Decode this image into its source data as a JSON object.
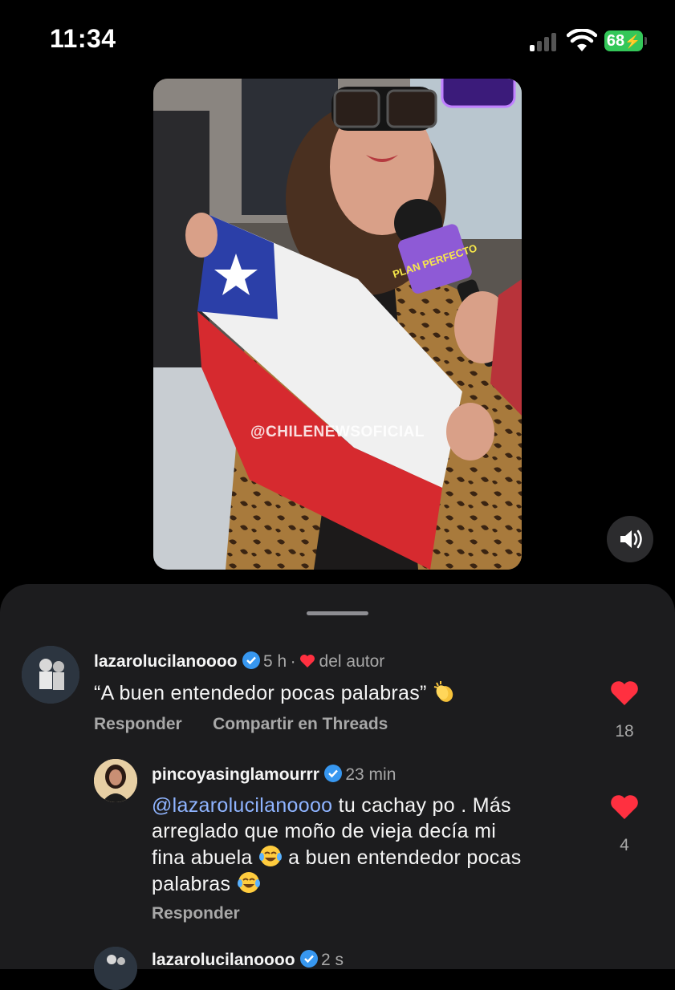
{
  "status_bar": {
    "time": "11:34",
    "battery": "68"
  },
  "video": {
    "watermark": "@CHILENEWSOFICIAL",
    "mic_text": "PLAN PERFECTO"
  },
  "comments": [
    {
      "username": "lazarolucilanoooo",
      "age": "5 h",
      "author_like": "del autor",
      "text": "“A buen entendedor pocas palabras”",
      "emoji": "clapping-hands-emoji",
      "reply_label": "Responder",
      "share_label": "Compartir en Threads",
      "likes": "18"
    },
    {
      "username": "pincoyasinglamourrr",
      "age": "23 min",
      "mention": "@lazarolucilanoooo",
      "lines": [
        " tu cachay po . Más",
        "arreglado que moño de vieja decía mi",
        "fina abuela",
        " a buen entendedor pocas",
        "palabras"
      ],
      "emoji": "tears-of-joy-emoji",
      "reply_label": "Responder",
      "likes": "4"
    },
    {
      "username": "lazarolucilanoooo",
      "age": "2 s"
    }
  ],
  "colors": {
    "heart": "#ff3040",
    "verified": "#3797f0",
    "mention": "#8fb4ff"
  }
}
